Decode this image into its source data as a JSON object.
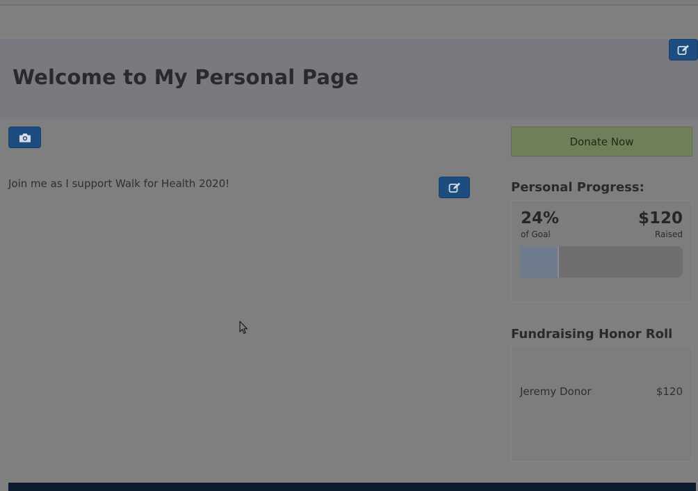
{
  "header": {
    "title": "Welcome to My Personal Page",
    "edit_icon": "edit-icon"
  },
  "main": {
    "photo_icon": "camera-icon",
    "intro_text": "Join me as I support Walk for Health 2020!",
    "edit_icon": "edit-icon"
  },
  "sidebar": {
    "donate_label": "Donate Now",
    "progress": {
      "heading": "Personal Progress:",
      "percent_value": "24%",
      "percent_label": "of Goal",
      "percent_fraction": 0.24,
      "raised_value": "$120",
      "raised_label": "Raised"
    },
    "honor_roll": {
      "heading": "Fundraising Honor Roll",
      "donors": [
        {
          "name": "Jeremy Donor",
          "amount": "$120"
        }
      ]
    }
  },
  "colors": {
    "primary_button": "#1d4d80",
    "donate_button": "#6e7f5a",
    "footer": "#0b1a2c"
  }
}
